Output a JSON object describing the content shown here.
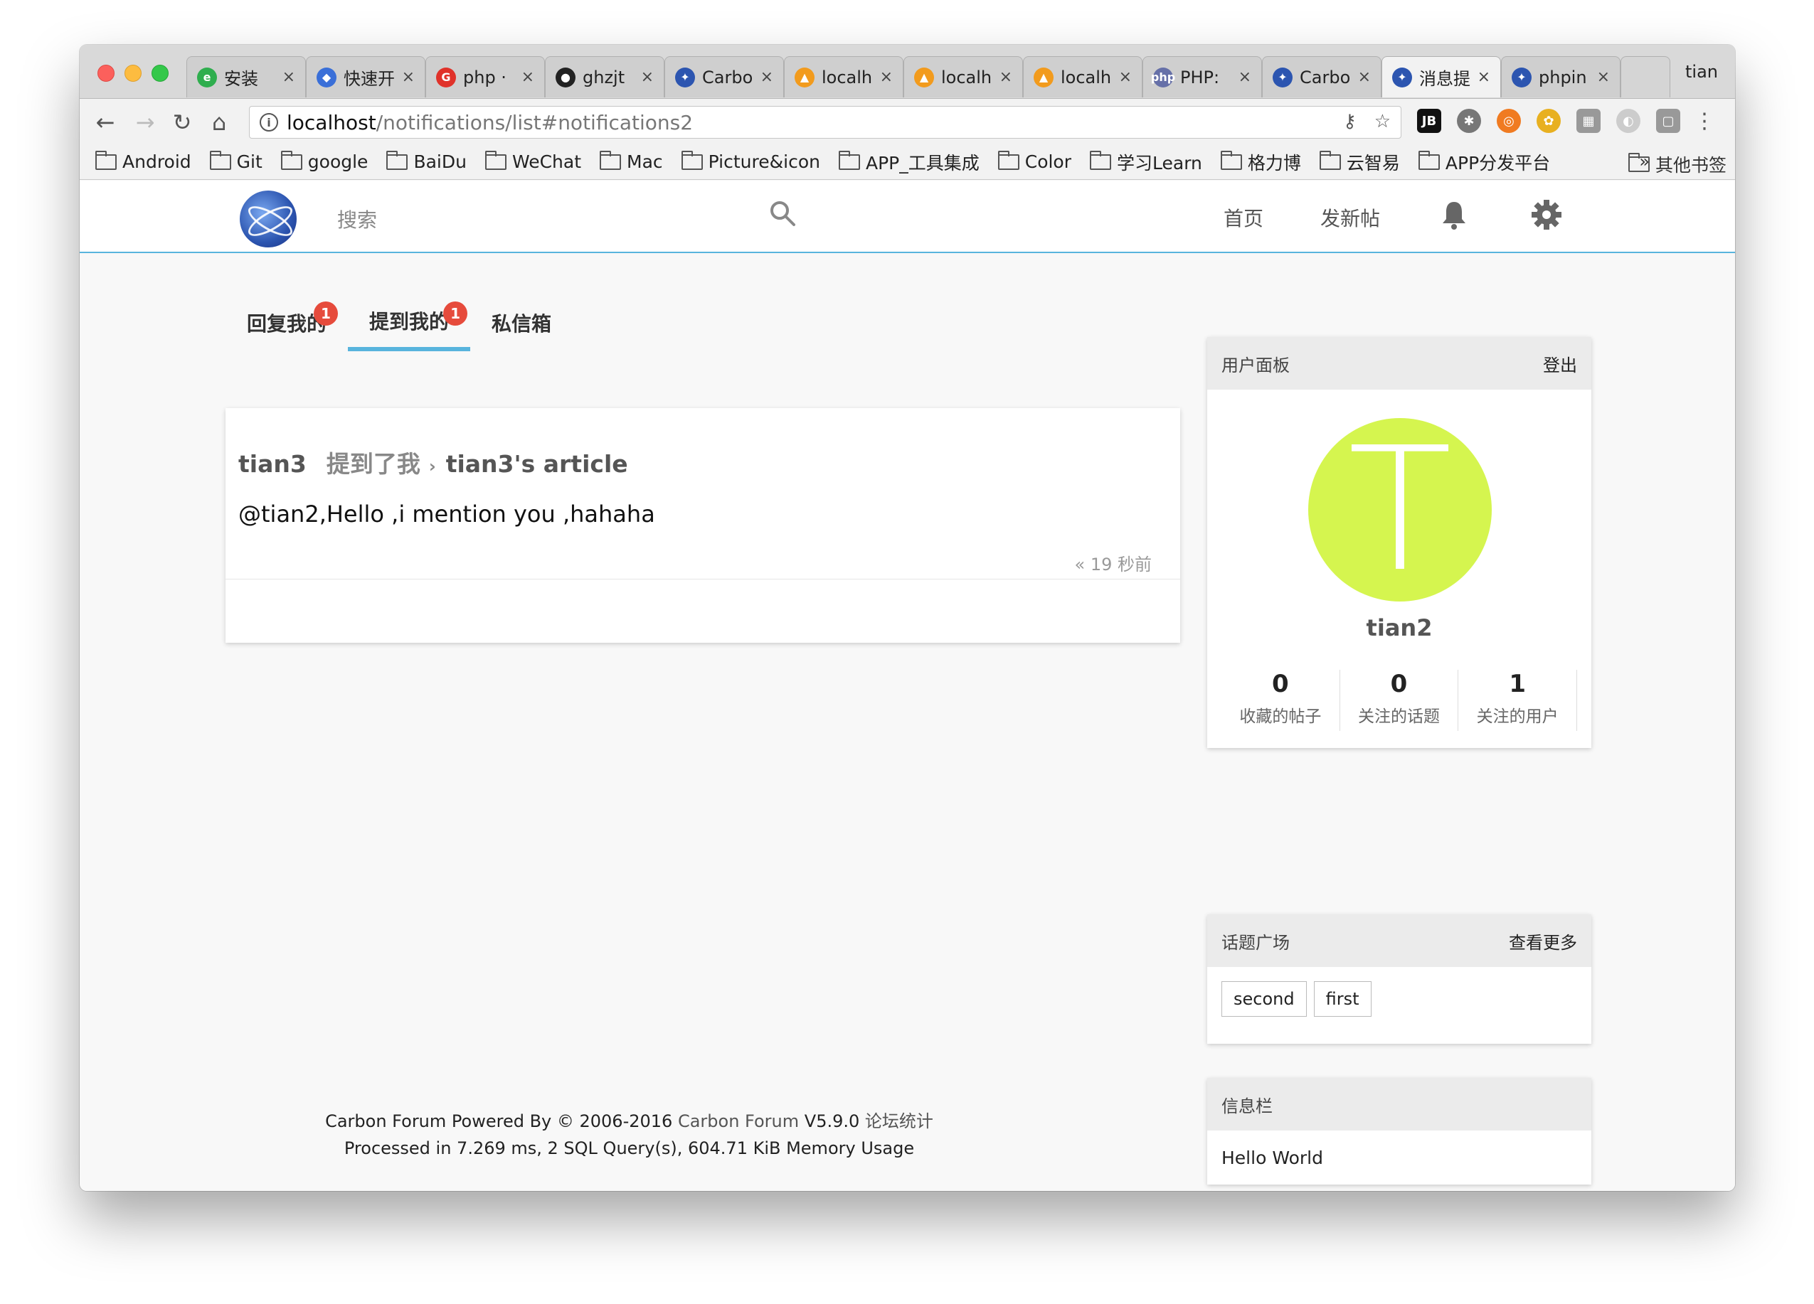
{
  "browser": {
    "tabs": [
      {
        "title": "安装",
        "color": "#2fae4e",
        "glyph": "e"
      },
      {
        "title": "快速开",
        "color": "#3a6fd8",
        "glyph": "◆"
      },
      {
        "title": "php ·",
        "color": "#e0322a",
        "glyph": "G"
      },
      {
        "title": "ghzjt",
        "color": "#222222",
        "glyph": "●"
      },
      {
        "title": "Carbo",
        "color": "#2c55b0",
        "glyph": "✦"
      },
      {
        "title": "localh",
        "color": "#f29b1d",
        "glyph": "▲"
      },
      {
        "title": "localh",
        "color": "#f29b1d",
        "glyph": "▲"
      },
      {
        "title": "localh",
        "color": "#f29b1d",
        "glyph": "▲"
      },
      {
        "title": "PHP:",
        "color": "#6670a8",
        "glyph": "php"
      },
      {
        "title": "Carbo",
        "color": "#2c55b0",
        "glyph": "✦"
      },
      {
        "title": "消息提",
        "color": "#2c55b0",
        "glyph": "✦"
      },
      {
        "title": "phpin",
        "color": "#2c55b0",
        "glyph": "✦"
      }
    ],
    "active_tab_index": 10,
    "profile_name": "tian",
    "url_host": "localhost",
    "url_path": "/notifications/list#notifications2",
    "bookmarks": [
      "Android",
      "Git",
      "google",
      "BaiDu",
      "WeChat",
      "Mac",
      "Picture&icon",
      "APP_工具集成",
      "Color",
      "学习Learn",
      "格力博",
      "云智易",
      "APP分发平台"
    ],
    "bookmarks_more": "»",
    "bookmarks_other": "其他书签"
  },
  "header": {
    "search_label": "搜索",
    "nav": {
      "home": "首页",
      "new_post": "发新帖"
    }
  },
  "notifications": {
    "tabs": [
      {
        "label": "回复我的",
        "badge": "1"
      },
      {
        "label": "提到我的",
        "badge": "1"
      },
      {
        "label": "私信箱",
        "badge": ""
      }
    ],
    "active_tab": 1,
    "items": [
      {
        "user": "tian3",
        "action": "提到了我",
        "separator": "›",
        "article": "tian3's article",
        "content": "@tian2,Hello ,i mention you ,hahaha",
        "time": "«  19 秒前"
      }
    ]
  },
  "sidebar": {
    "user_panel": {
      "title": "用户面板",
      "logout": "登出",
      "avatar_letter": "T",
      "avatar_color": "#d5f54f",
      "username": "tian2",
      "stats": [
        {
          "value": "0",
          "label": "收藏的帖子"
        },
        {
          "value": "0",
          "label": "关注的话题"
        },
        {
          "value": "1",
          "label": "关注的用户"
        }
      ]
    },
    "topics_panel": {
      "title": "话题广场",
      "more": "查看更多",
      "tags": [
        "second",
        "first"
      ]
    },
    "info_panel": {
      "title": "信息栏",
      "body": "Hello World"
    }
  },
  "footer": {
    "prefix": "Carbon Forum Powered By © 2006-2016",
    "link": "Carbon Forum",
    "version": "V5.9.0",
    "stats_link": "论坛统计",
    "line2": "Processed in 7.269 ms, 2 SQL Query(s), 604.71 KiB Memory Usage"
  }
}
